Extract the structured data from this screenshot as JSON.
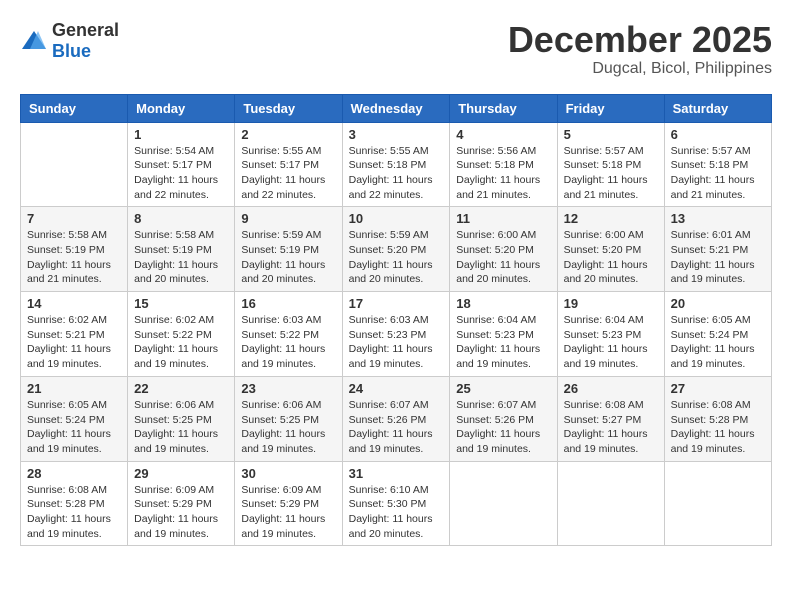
{
  "header": {
    "logo": {
      "general": "General",
      "blue": "Blue"
    },
    "title": "December 2025",
    "location": "Dugcal, Bicol, Philippines"
  },
  "weekdays": [
    "Sunday",
    "Monday",
    "Tuesday",
    "Wednesday",
    "Thursday",
    "Friday",
    "Saturday"
  ],
  "weeks": [
    [
      {
        "day": "",
        "sunrise": "",
        "sunset": "",
        "daylight": ""
      },
      {
        "day": "1",
        "sunrise": "Sunrise: 5:54 AM",
        "sunset": "Sunset: 5:17 PM",
        "daylight": "Daylight: 11 hours and 22 minutes."
      },
      {
        "day": "2",
        "sunrise": "Sunrise: 5:55 AM",
        "sunset": "Sunset: 5:17 PM",
        "daylight": "Daylight: 11 hours and 22 minutes."
      },
      {
        "day": "3",
        "sunrise": "Sunrise: 5:55 AM",
        "sunset": "Sunset: 5:18 PM",
        "daylight": "Daylight: 11 hours and 22 minutes."
      },
      {
        "day": "4",
        "sunrise": "Sunrise: 5:56 AM",
        "sunset": "Sunset: 5:18 PM",
        "daylight": "Daylight: 11 hours and 21 minutes."
      },
      {
        "day": "5",
        "sunrise": "Sunrise: 5:57 AM",
        "sunset": "Sunset: 5:18 PM",
        "daylight": "Daylight: 11 hours and 21 minutes."
      },
      {
        "day": "6",
        "sunrise": "Sunrise: 5:57 AM",
        "sunset": "Sunset: 5:18 PM",
        "daylight": "Daylight: 11 hours and 21 minutes."
      }
    ],
    [
      {
        "day": "7",
        "sunrise": "Sunrise: 5:58 AM",
        "sunset": "Sunset: 5:19 PM",
        "daylight": "Daylight: 11 hours and 21 minutes."
      },
      {
        "day": "8",
        "sunrise": "Sunrise: 5:58 AM",
        "sunset": "Sunset: 5:19 PM",
        "daylight": "Daylight: 11 hours and 20 minutes."
      },
      {
        "day": "9",
        "sunrise": "Sunrise: 5:59 AM",
        "sunset": "Sunset: 5:19 PM",
        "daylight": "Daylight: 11 hours and 20 minutes."
      },
      {
        "day": "10",
        "sunrise": "Sunrise: 5:59 AM",
        "sunset": "Sunset: 5:20 PM",
        "daylight": "Daylight: 11 hours and 20 minutes."
      },
      {
        "day": "11",
        "sunrise": "Sunrise: 6:00 AM",
        "sunset": "Sunset: 5:20 PM",
        "daylight": "Daylight: 11 hours and 20 minutes."
      },
      {
        "day": "12",
        "sunrise": "Sunrise: 6:00 AM",
        "sunset": "Sunset: 5:20 PM",
        "daylight": "Daylight: 11 hours and 20 minutes."
      },
      {
        "day": "13",
        "sunrise": "Sunrise: 6:01 AM",
        "sunset": "Sunset: 5:21 PM",
        "daylight": "Daylight: 11 hours and 19 minutes."
      }
    ],
    [
      {
        "day": "14",
        "sunrise": "Sunrise: 6:02 AM",
        "sunset": "Sunset: 5:21 PM",
        "daylight": "Daylight: 11 hours and 19 minutes."
      },
      {
        "day": "15",
        "sunrise": "Sunrise: 6:02 AM",
        "sunset": "Sunset: 5:22 PM",
        "daylight": "Daylight: 11 hours and 19 minutes."
      },
      {
        "day": "16",
        "sunrise": "Sunrise: 6:03 AM",
        "sunset": "Sunset: 5:22 PM",
        "daylight": "Daylight: 11 hours and 19 minutes."
      },
      {
        "day": "17",
        "sunrise": "Sunrise: 6:03 AM",
        "sunset": "Sunset: 5:23 PM",
        "daylight": "Daylight: 11 hours and 19 minutes."
      },
      {
        "day": "18",
        "sunrise": "Sunrise: 6:04 AM",
        "sunset": "Sunset: 5:23 PM",
        "daylight": "Daylight: 11 hours and 19 minutes."
      },
      {
        "day": "19",
        "sunrise": "Sunrise: 6:04 AM",
        "sunset": "Sunset: 5:23 PM",
        "daylight": "Daylight: 11 hours and 19 minutes."
      },
      {
        "day": "20",
        "sunrise": "Sunrise: 6:05 AM",
        "sunset": "Sunset: 5:24 PM",
        "daylight": "Daylight: 11 hours and 19 minutes."
      }
    ],
    [
      {
        "day": "21",
        "sunrise": "Sunrise: 6:05 AM",
        "sunset": "Sunset: 5:24 PM",
        "daylight": "Daylight: 11 hours and 19 minutes."
      },
      {
        "day": "22",
        "sunrise": "Sunrise: 6:06 AM",
        "sunset": "Sunset: 5:25 PM",
        "daylight": "Daylight: 11 hours and 19 minutes."
      },
      {
        "day": "23",
        "sunrise": "Sunrise: 6:06 AM",
        "sunset": "Sunset: 5:25 PM",
        "daylight": "Daylight: 11 hours and 19 minutes."
      },
      {
        "day": "24",
        "sunrise": "Sunrise: 6:07 AM",
        "sunset": "Sunset: 5:26 PM",
        "daylight": "Daylight: 11 hours and 19 minutes."
      },
      {
        "day": "25",
        "sunrise": "Sunrise: 6:07 AM",
        "sunset": "Sunset: 5:26 PM",
        "daylight": "Daylight: 11 hours and 19 minutes."
      },
      {
        "day": "26",
        "sunrise": "Sunrise: 6:08 AM",
        "sunset": "Sunset: 5:27 PM",
        "daylight": "Daylight: 11 hours and 19 minutes."
      },
      {
        "day": "27",
        "sunrise": "Sunrise: 6:08 AM",
        "sunset": "Sunset: 5:28 PM",
        "daylight": "Daylight: 11 hours and 19 minutes."
      }
    ],
    [
      {
        "day": "28",
        "sunrise": "Sunrise: 6:08 AM",
        "sunset": "Sunset: 5:28 PM",
        "daylight": "Daylight: 11 hours and 19 minutes."
      },
      {
        "day": "29",
        "sunrise": "Sunrise: 6:09 AM",
        "sunset": "Sunset: 5:29 PM",
        "daylight": "Daylight: 11 hours and 19 minutes."
      },
      {
        "day": "30",
        "sunrise": "Sunrise: 6:09 AM",
        "sunset": "Sunset: 5:29 PM",
        "daylight": "Daylight: 11 hours and 19 minutes."
      },
      {
        "day": "31",
        "sunrise": "Sunrise: 6:10 AM",
        "sunset": "Sunset: 5:30 PM",
        "daylight": "Daylight: 11 hours and 20 minutes."
      },
      {
        "day": "",
        "sunrise": "",
        "sunset": "",
        "daylight": ""
      },
      {
        "day": "",
        "sunrise": "",
        "sunset": "",
        "daylight": ""
      },
      {
        "day": "",
        "sunrise": "",
        "sunset": "",
        "daylight": ""
      }
    ]
  ]
}
